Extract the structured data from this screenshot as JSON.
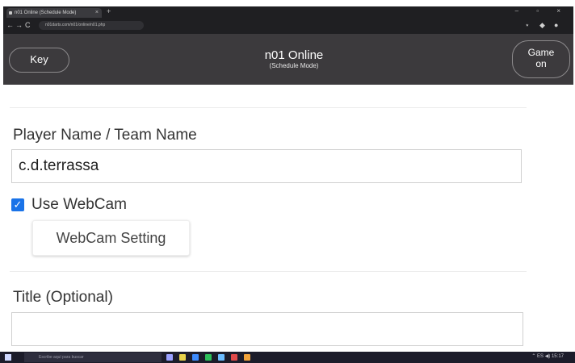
{
  "browser": {
    "tab_title": "n01 Online (Schedule Mode)",
    "tab_close": "×",
    "new_tab": "+",
    "window_controls": "– ▫ ×",
    "nav_icons": [
      "←",
      "→",
      "C",
      "🔒"
    ],
    "url": "n01darts.com/n01/online/n01.php",
    "ext_icons": [
      "⋆",
      "◆",
      "●"
    ]
  },
  "header": {
    "key_label": "Key",
    "title": "n01 Online",
    "subtitle": "(Schedule Mode)",
    "game_on_line1": "Game",
    "game_on_line2": "on"
  },
  "form": {
    "player_label": "Player Name / Team Name",
    "player_value": "c.d.terrassa",
    "webcam_checked": true,
    "webcam_check_glyph": "✓",
    "webcam_label": "Use WebCam",
    "webcam_setting_label": "WebCam Setting",
    "title_label": "Title (Optional)",
    "title_value": ""
  },
  "taskbar": {
    "search_placeholder": "Escribe aquí para buscar",
    "tray_text": "⌃ ES  ◀)  15:17",
    "icon_colors": [
      "#9aa0ff",
      "#e8d24a",
      "#3d8bfd",
      "#2dbf5a",
      "#6bbcff",
      "#e04a4a",
      "#f2a33a"
    ]
  },
  "colors": {
    "header_bg": "#3c3a3d",
    "checkbox_accent": "#1a73e8"
  }
}
